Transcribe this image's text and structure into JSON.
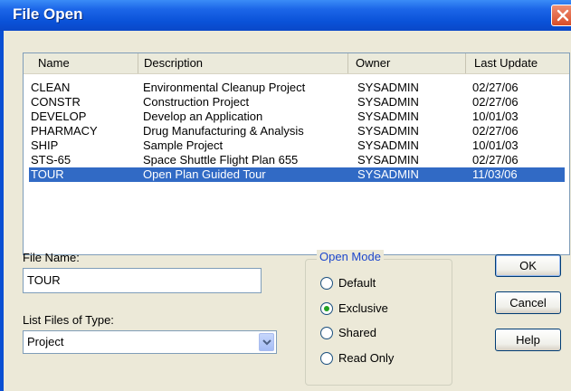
{
  "window": {
    "title": "File Open"
  },
  "list": {
    "columns": [
      "Name",
      "Description",
      "Owner",
      "Last Update"
    ],
    "rows": [
      [
        "CLEAN",
        "Environmental Cleanup Project",
        "SYSADMIN",
        "02/27/06"
      ],
      [
        "CONSTR",
        "Construction Project",
        "SYSADMIN",
        "02/27/06"
      ],
      [
        "DEVELOP",
        "Develop an Application",
        "SYSADMIN",
        "10/01/03"
      ],
      [
        "PHARMACY",
        "Drug Manufacturing & Analysis",
        "SYSADMIN",
        "02/27/06"
      ],
      [
        "SHIP",
        "Sample Project",
        "SYSADMIN",
        "10/01/03"
      ],
      [
        "STS-65",
        "Space Shuttle Flight Plan 655",
        "SYSADMIN",
        "02/27/06"
      ],
      [
        "TOUR",
        "Open Plan Guided Tour",
        "SYSADMIN",
        "11/03/06"
      ]
    ],
    "selected_index": 6
  },
  "file_name": {
    "label": "File Name:",
    "value": "TOUR"
  },
  "file_type": {
    "label": "List Files of Type:",
    "value": "Project"
  },
  "open_mode": {
    "label": "Open Mode",
    "options": [
      "Default",
      "Exclusive",
      "Shared",
      "Read Only"
    ],
    "selected": "Exclusive"
  },
  "buttons": {
    "ok": "OK",
    "cancel": "Cancel",
    "help": "Help"
  },
  "colors": {
    "titlebar": "#0a52d8",
    "selection": "#316ac5",
    "group_title": "#1e47cc",
    "radio_dot": "#21a121"
  }
}
